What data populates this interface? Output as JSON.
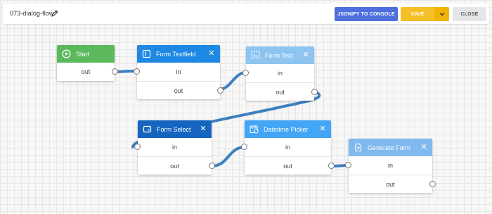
{
  "header": {
    "flow_name": "073-dialog-flow",
    "jsonify_label": "JSONIFY TO CONSOLE",
    "save_label": "SAVE",
    "close_label": "CLOSE"
  },
  "icons": {
    "edit": "pencil-icon",
    "save_dropdown": "chevron-down-icon",
    "node_close": "close-icon"
  },
  "colors": {
    "start": "#5cb85c",
    "form_textfield": "#1e88e5",
    "form_text": "#8ec4f0",
    "form_select": "#1565c0",
    "datetime_picker": "#42a5f5",
    "generate_form": "#7fb9ee",
    "edge": "#3f7fbf",
    "jsonify": "#4f6fde",
    "save": "#f5c027"
  },
  "nodes": {
    "start": {
      "title": "Start",
      "out": "out"
    },
    "form_textfield": {
      "title": "Form Textfield",
      "in": "in",
      "out": "out",
      "close": "✕"
    },
    "form_text": {
      "title": "Form Text",
      "in": "in",
      "out": "out",
      "close": "✕"
    },
    "form_select": {
      "title": "Form Select",
      "in": "in",
      "out": "out",
      "close": "✕"
    },
    "datetime_picker": {
      "title": "Datetime Picker",
      "in": "in",
      "out": "out",
      "close": "✕"
    },
    "generate_form": {
      "title": "Generate Form",
      "in": "in",
      "out": "out",
      "close": "✕"
    }
  }
}
